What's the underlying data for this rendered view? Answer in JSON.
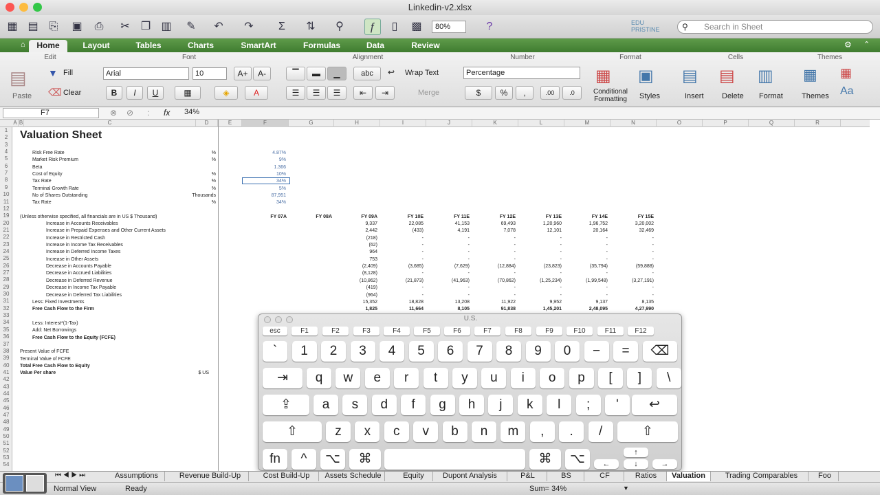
{
  "window": {
    "title": "Linkedin-v2.xlsx",
    "zoom": "80%",
    "search_placeholder": "Search in Sheet",
    "brand": "EDU PRISTINE"
  },
  "ribbon_tabs": [
    "Home",
    "Layout",
    "Tables",
    "Charts",
    "SmartArt",
    "Formulas",
    "Data",
    "Review"
  ],
  "groups": {
    "edit": "Edit",
    "font": "Font",
    "alignment": "Alignment",
    "number": "Number",
    "format": "Format",
    "cells": "Cells",
    "themes": "Themes"
  },
  "ribbon": {
    "paste": "Paste",
    "fill": "Fill",
    "clear": "Clear",
    "font_name": "Arial",
    "font_size": "10",
    "wrap_text": "Wrap Text",
    "merge": "Merge",
    "number_format": "Percentage",
    "conditional_formatting": "Conditional Formatting",
    "styles": "Styles",
    "insert": "Insert",
    "delete": "Delete",
    "format": "Format",
    "themes": "Themes",
    "bold": "B",
    "italic": "I",
    "underline": "U",
    "percent": "%",
    "comma": ","
  },
  "formula_bar": {
    "name_box": "F7",
    "fx": "fx",
    "value": "34%"
  },
  "columns": [
    "A",
    "B",
    "C",
    "D",
    "E",
    "F",
    "G",
    "H",
    "I",
    "J",
    "K",
    "L",
    "M",
    "N",
    "O",
    "P",
    "Q",
    "R"
  ],
  "rows": [
    "1",
    "2",
    "3",
    "4",
    "5",
    "6",
    "7",
    "8",
    "9",
    "10",
    "11",
    "12",
    "19",
    "20",
    "21",
    "22",
    "23",
    "24",
    "25",
    "26",
    "27",
    "28",
    "29",
    "30",
    "31",
    "32",
    "33",
    "34",
    "35",
    "36",
    "37",
    "38",
    "39",
    "40",
    "41",
    "42",
    "43",
    "44",
    "45",
    "46",
    "47",
    "48",
    "49",
    "50",
    "51",
    "52",
    "53",
    "54"
  ],
  "sheet": {
    "title": "Valuation Sheet",
    "inputs": [
      {
        "label": "Risk Free Rate",
        "unit": "%",
        "value": "4.87%"
      },
      {
        "label": "Market Risk Premium",
        "unit": "%",
        "value": "9%"
      },
      {
        "label": "Beta",
        "unit": "",
        "value": "1.366"
      },
      {
        "label": "Cost of Equity",
        "unit": "%",
        "value": "10%"
      },
      {
        "label": "Tax Rate",
        "unit": "%",
        "value": "34%"
      },
      {
        "label": "Terminal Growth Rate",
        "unit": "%",
        "value": "5%"
      },
      {
        "label": "No of Shares Outstanding",
        "unit": "Thousands",
        "value": "87,951"
      },
      {
        "label": "Tax Rate",
        "unit": "%",
        "value": "34%"
      }
    ],
    "header_note": "(Unless otherwise specified, all financials are in US $ Thousand)",
    "years": [
      "FY 07A",
      "FY 08A",
      "FY 09A",
      "FY 10E",
      "FY 11E",
      "FY 12E",
      "FY 13E",
      "FY 14E",
      "FY 15E"
    ],
    "lines": [
      {
        "label": "Increase in Accounts Receivables",
        "v": [
          "",
          "",
          "9,337",
          "22,085",
          "41,153",
          "69,493",
          "1,20,960",
          "1,96,752",
          "3,20,002"
        ]
      },
      {
        "label": "Increase in Prepaid Expenses and Other Current Assets",
        "v": [
          "",
          "",
          "2,442",
          "(433)",
          "4,191",
          "7,078",
          "12,101",
          "20,164",
          "32,469"
        ]
      },
      {
        "label": "Increase in Restricted Cash",
        "v": [
          "",
          "",
          "(218)",
          "-",
          "-",
          "-",
          "-",
          "-",
          "-"
        ]
      },
      {
        "label": "Increase in Income Tax Receivables",
        "v": [
          "",
          "",
          "(62)",
          "-",
          "-",
          "-",
          "-",
          "-",
          "-"
        ]
      },
      {
        "label": "Increase in Deferred Income Taxes",
        "v": [
          "",
          "",
          "964",
          "-",
          "-",
          "-",
          "-",
          "-",
          "-"
        ]
      },
      {
        "label": "Increase in Other Assets",
        "v": [
          "",
          "",
          "753",
          "-",
          "-",
          "-",
          "-",
          "-",
          "-"
        ]
      },
      {
        "label": "Decrease in Accounts Payable",
        "v": [
          "",
          "",
          "(2,409)",
          "(3,685)",
          "(7,629)",
          "(12,884)",
          "(23,823)",
          "(35,794)",
          "(59,888)"
        ]
      },
      {
        "label": "Decrease in Accrued Liabilities",
        "v": [
          "",
          "",
          "(8,128)",
          "-",
          "-",
          "-",
          "-",
          "-",
          "-"
        ]
      },
      {
        "label": "Decrease in Deferred Revenue",
        "v": [
          "",
          "",
          "(10,862)",
          "(21,873)",
          "(41,963)",
          "(70,862)",
          "(1,25,234)",
          "(1,99,548)",
          "(3,27,191)"
        ]
      },
      {
        "label": "Decrease in Income Tax Payable",
        "v": [
          "",
          "",
          "(419)",
          "-",
          "-",
          "-",
          "-",
          "-",
          "-"
        ]
      },
      {
        "label": "Decrease in Deferred Tax Liabilities",
        "v": [
          "",
          "",
          "(964)",
          "-",
          "-",
          "-",
          "-",
          "-",
          "-"
        ]
      },
      {
        "label": "Less: Fixed Investments",
        "v": [
          "",
          "",
          "15,352",
          "18,828",
          "13,208",
          "11,922",
          "9,952",
          "9,137",
          "8,135"
        ]
      },
      {
        "label": "Free Cash Flow to the Firm",
        "v": [
          "",
          "",
          "1,825",
          "11,664",
          "8,105",
          "91,838",
          "1,45,201",
          "2,48,095",
          "4,27,990"
        ]
      },
      {
        "label": "",
        "v": [
          "",
          "",
          "",
          "",
          "",
          "",
          "",
          "",
          ""
        ]
      },
      {
        "label": "Less: Interest*(1-Tax)",
        "v": [
          "",
          "",
          "",
          "",
          "",
          "",
          "",
          "",
          ""
        ]
      },
      {
        "label": "Add: Net Borrowings",
        "v": [
          "",
          "",
          "",
          "",
          "",
          "",
          "",
          "",
          ""
        ]
      },
      {
        "label": "Free Cash Flow to the Equity (FCFE)",
        "v": [
          "",
          "",
          "",
          "",
          "",
          "",
          "",
          "",
          ""
        ]
      },
      {
        "label": "",
        "v": [
          "",
          "",
          "",
          "",
          "",
          "",
          "",
          "",
          ""
        ]
      },
      {
        "label": "Present Value of FCFE",
        "v": [
          "",
          "",
          "",
          "",
          "",
          "",
          "",
          "",
          ""
        ]
      },
      {
        "label": "Terminal Value of FCFE",
        "v": [
          "",
          "",
          "",
          "",
          "",
          "",
          "",
          "",
          ""
        ]
      },
      {
        "label": "Total Free Cash Flow to Equity",
        "v": [
          "",
          "",
          "",
          "",
          "",
          "",
          "",
          "",
          ""
        ]
      },
      {
        "label": "Value Per share",
        "unit": "$ US",
        "v": [
          "",
          "",
          "",
          "",
          "",
          "",
          "",
          "",
          ""
        ]
      }
    ]
  },
  "keyboard": {
    "title": "U.S.",
    "fkeys": [
      "esc",
      "F1",
      "F2",
      "F3",
      "F4",
      "F5",
      "F6",
      "F7",
      "F8",
      "F9",
      "F10",
      "F11",
      "F12"
    ],
    "row1": [
      "`",
      "1",
      "2",
      "3",
      "4",
      "5",
      "6",
      "7",
      "8",
      "9",
      "0",
      "−",
      "=",
      "⌫"
    ],
    "row2": [
      "⇥",
      "q",
      "w",
      "e",
      "r",
      "t",
      "y",
      "u",
      "i",
      "o",
      "p",
      "[",
      "]",
      "\\"
    ],
    "row3": [
      "⇪",
      "a",
      "s",
      "d",
      "f",
      "g",
      "h",
      "j",
      "k",
      "l",
      ";",
      "'",
      "↩"
    ],
    "row4": [
      "⇧",
      "z",
      "x",
      "c",
      "v",
      "b",
      "n",
      "m",
      ",",
      ".",
      "/",
      "⇧"
    ],
    "row5": [
      "fn",
      "^",
      "⌥",
      "⌘",
      "",
      "⌘",
      "⌥",
      "←",
      "↑",
      "↓",
      "→"
    ]
  },
  "sheet_tabs": [
    "Assumptions",
    "Revenue Build-Up",
    "Cost Build-Up",
    "Assets Schedule",
    "Equity",
    "Dupont Analysis",
    "P&L",
    "BS",
    "CF",
    "Ratios",
    "Valuation",
    "Trading Comparables",
    "Foo"
  ],
  "status": {
    "view": "Normal View",
    "ready": "Ready",
    "sum": "Sum= 34%"
  }
}
